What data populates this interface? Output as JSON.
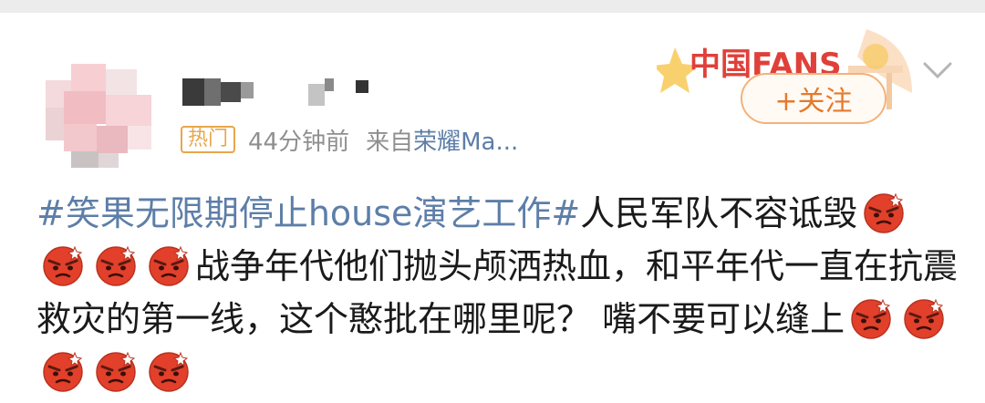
{
  "post": {
    "hot_badge": "热门",
    "time": "44分钟前",
    "from_prefix": "来自",
    "from_device": "荣耀Ma...",
    "follow_label": "+关注",
    "fans_badge_text": "中国FANS",
    "text": {
      "topic": "#笑果无限期停止house演艺工作#",
      "part1": "人民军队不容诋毁",
      "part2": "战争年代他们抛头颅洒热血，和平年代一直在抗震救灾的第一线，这个憨批在哪里呢？ 嘴不要可以缝上"
    },
    "emoji_name": "angry-face-emoji"
  },
  "colors": {
    "topic": "#5d7ea8",
    "hot_badge": "#e8a64b",
    "follow": "#e47a2c"
  }
}
